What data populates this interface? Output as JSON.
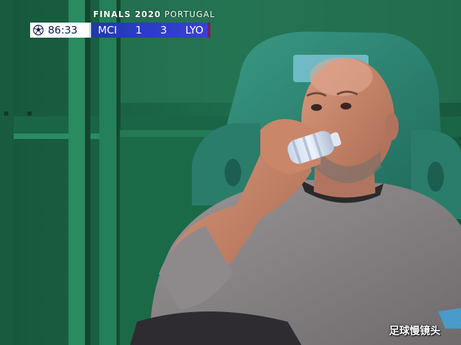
{
  "overlay": {
    "competition_bold": "FINALS 2020",
    "competition_rest": "PORTUGAL",
    "clock": "86:33",
    "home_team": "MCI",
    "home_score": "1",
    "away_score": "3",
    "away_team": "LYO",
    "colors": {
      "clock_bg": "#ffffff",
      "clock_text": "#0b1a4a",
      "score_bar": "#2b3cc6",
      "accent_tab": "#7d1f5a"
    }
  },
  "watermark": {
    "text": "足球慢镜头"
  },
  "scene": {
    "icon": "football-icon",
    "colors": {
      "wall": "#1d6b4a",
      "seat": "#2f8a78",
      "shirt": "#8e8a8c",
      "skin": "#c9876a"
    }
  }
}
